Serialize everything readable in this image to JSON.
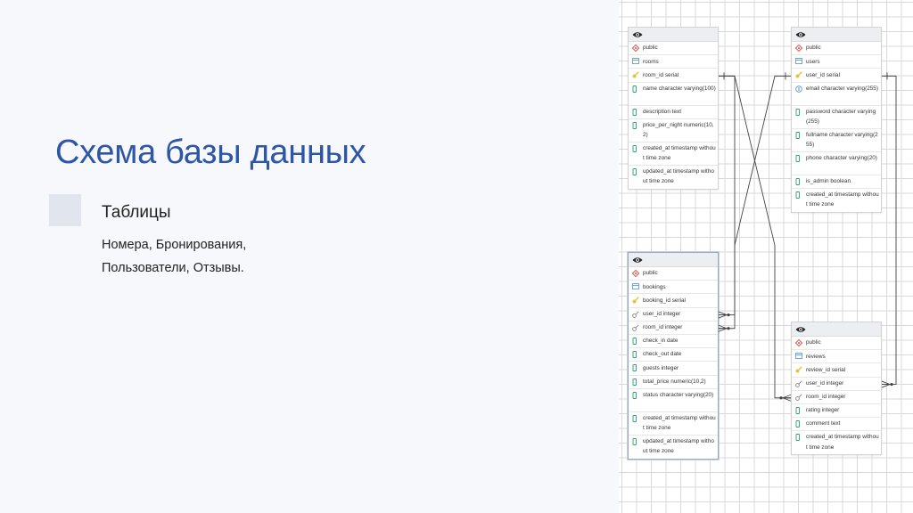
{
  "slide": {
    "title": "Схема базы данных",
    "bullet_heading": "Таблицы",
    "bullet_text_lines": [
      "Номера, Бронирования,",
      "Пользователи, Отзывы."
    ]
  },
  "colors": {
    "title": "#2e56a6",
    "key_icon": "#e3c43a",
    "column_icon": "#2aa07a",
    "schema_icon": "#d9534f",
    "table_icon": "#4a90d9"
  },
  "tables": [
    {
      "id": "rooms",
      "schema": "public",
      "name": "rooms",
      "columns": [
        {
          "text": "room_id serial",
          "icon": "key-icon"
        },
        {
          "text": "name character varying(100)",
          "icon": "column-icon"
        },
        {
          "text": "description text",
          "icon": "column-icon"
        },
        {
          "text": "price_per_night numeric(10,2)",
          "icon": "column-icon"
        },
        {
          "text": "created_at timestamp without time zone",
          "icon": "column-icon"
        },
        {
          "text": "updated_at timestamp without time zone",
          "icon": "column-icon"
        }
      ]
    },
    {
      "id": "users",
      "schema": "public",
      "name": "users",
      "columns": [
        {
          "text": "user_id serial",
          "icon": "key-icon"
        },
        {
          "text": "email character varying(255)",
          "icon": "unique-icon"
        },
        {
          "text": "password character varying(255)",
          "icon": "column-icon"
        },
        {
          "text": "fullname character varying(255)",
          "icon": "column-icon"
        },
        {
          "text": "phone character varying(20)",
          "icon": "column-icon"
        },
        {
          "text": "is_admin boolean",
          "icon": "column-icon"
        },
        {
          "text": "created_at timestamp without time zone",
          "icon": "column-icon"
        }
      ]
    },
    {
      "id": "bookings",
      "schema": "public",
      "name": "bookings",
      "columns": [
        {
          "text": "booking_id serial",
          "icon": "key-icon"
        },
        {
          "text": "user_id integer",
          "icon": "foreign-key-icon"
        },
        {
          "text": "room_id integer",
          "icon": "foreign-key-icon"
        },
        {
          "text": "check_in date",
          "icon": "column-icon"
        },
        {
          "text": "check_out date",
          "icon": "column-icon"
        },
        {
          "text": "guests integer",
          "icon": "column-icon"
        },
        {
          "text": "total_price numeric(10,2)",
          "icon": "column-icon"
        },
        {
          "text": "status character varying(20)",
          "icon": "column-icon"
        },
        {
          "text": "created_at timestamp without time zone",
          "icon": "column-icon"
        },
        {
          "text": "updated_at timestamp without time zone",
          "icon": "column-icon"
        }
      ]
    },
    {
      "id": "reviews",
      "schema": "public",
      "name": "reviews",
      "columns": [
        {
          "text": "review_id serial",
          "icon": "key-icon"
        },
        {
          "text": "user_id integer",
          "icon": "foreign-key-icon"
        },
        {
          "text": "room_id integer",
          "icon": "foreign-key-icon"
        },
        {
          "text": "rating integer",
          "icon": "column-icon"
        },
        {
          "text": "comment text",
          "icon": "column-icon"
        },
        {
          "text": "created_at timestamp without time zone",
          "icon": "column-icon"
        }
      ]
    }
  ],
  "relations": [
    {
      "from": "rooms.room_id",
      "to": "bookings.room_id"
    },
    {
      "from": "users.user_id",
      "to": "bookings.user_id"
    },
    {
      "from": "rooms.room_id",
      "to": "reviews.room_id"
    },
    {
      "from": "users.user_id",
      "to": "reviews.user_id"
    }
  ]
}
